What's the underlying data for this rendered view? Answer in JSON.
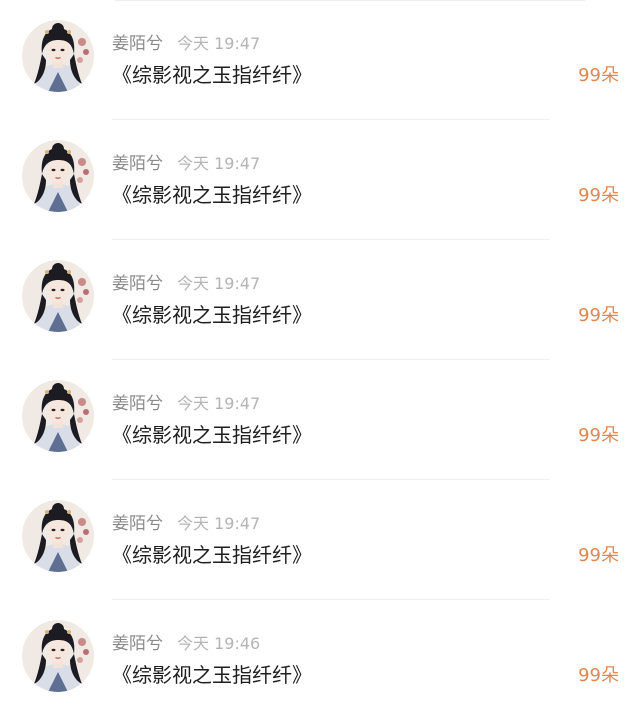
{
  "colors": {
    "name": "#8a8a8a",
    "time": "#b4b4b4",
    "title": "#1e1e1e",
    "count": "#e0884e"
  },
  "list": {
    "items": [
      {
        "author": "姜陌兮",
        "time": "今天 19:47",
        "title": "《综影视之玉指纤纤》",
        "count": "99朵",
        "avatar_icon": "avatar-icon"
      },
      {
        "author": "姜陌兮",
        "time": "今天 19:47",
        "title": "《综影视之玉指纤纤》",
        "count": "99朵",
        "avatar_icon": "avatar-icon"
      },
      {
        "author": "姜陌兮",
        "time": "今天 19:47",
        "title": "《综影视之玉指纤纤》",
        "count": "99朵",
        "avatar_icon": "avatar-icon"
      },
      {
        "author": "姜陌兮",
        "time": "今天 19:47",
        "title": "《综影视之玉指纤纤》",
        "count": "99朵",
        "avatar_icon": "avatar-icon"
      },
      {
        "author": "姜陌兮",
        "time": "今天 19:47",
        "title": "《综影视之玉指纤纤》",
        "count": "99朵",
        "avatar_icon": "avatar-icon"
      },
      {
        "author": "姜陌兮",
        "time": "今天 19:46",
        "title": "《综影视之玉指纤纤》",
        "count": "99朵",
        "avatar_icon": "avatar-icon"
      }
    ]
  }
}
